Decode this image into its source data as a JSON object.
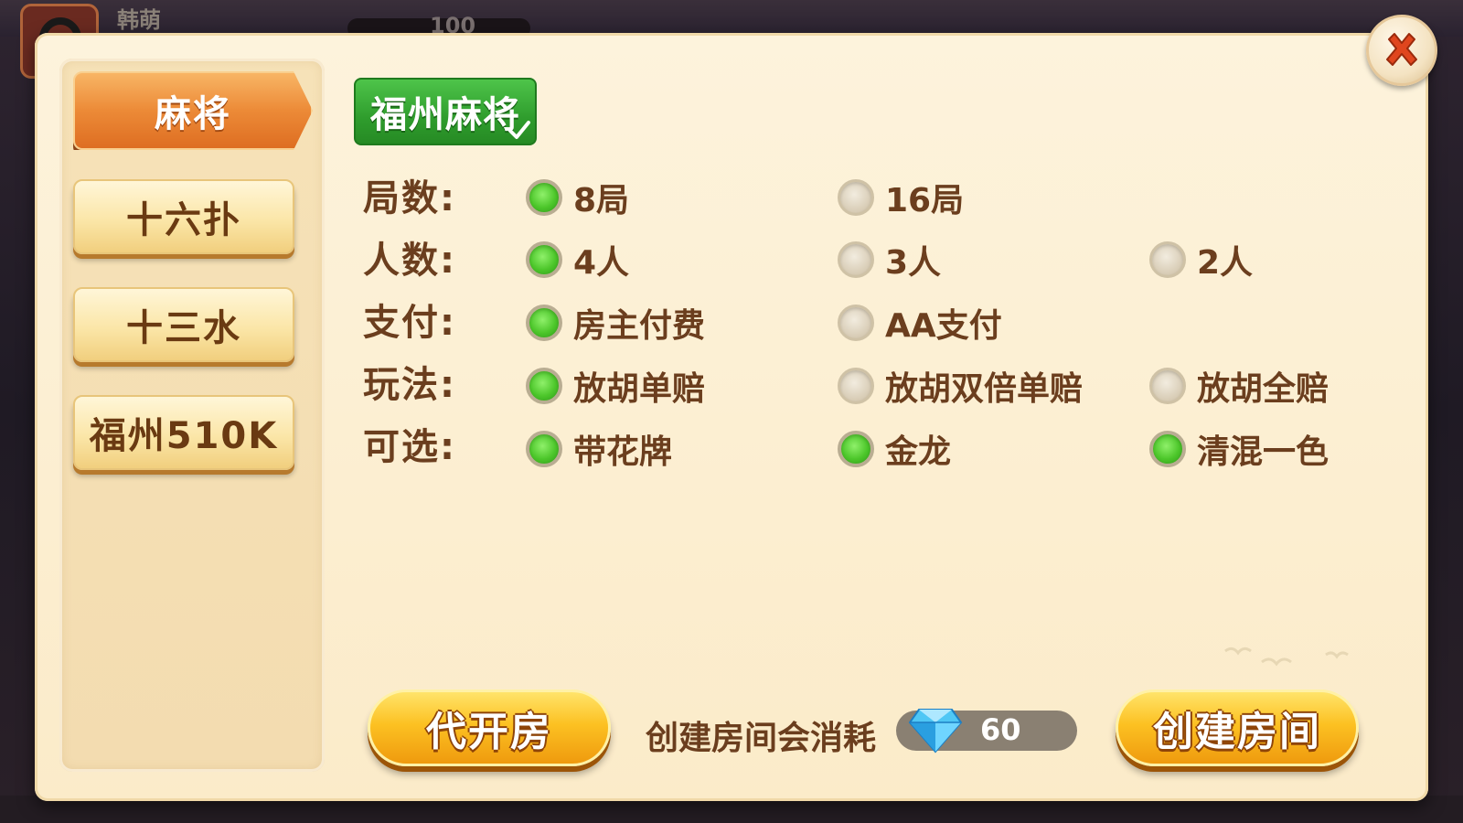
{
  "background": {
    "player_name": "韩萌",
    "coins": "100"
  },
  "dialog": {
    "close_icon": "close-x-icon"
  },
  "sidebar": {
    "items": [
      {
        "label": "麻将",
        "active": true
      },
      {
        "label": "十六扑",
        "active": false
      },
      {
        "label": "十三水",
        "active": false
      },
      {
        "label": "福州510K",
        "active": false
      }
    ]
  },
  "game_tag": {
    "label": "福州麻将",
    "selected": true
  },
  "rows": [
    {
      "label": "局数:",
      "options": [
        {
          "label": "8局",
          "checked": true
        },
        {
          "label": "16局",
          "checked": false
        }
      ]
    },
    {
      "label": "人数:",
      "options": [
        {
          "label": "4人",
          "checked": true
        },
        {
          "label": "3人",
          "checked": false
        },
        {
          "label": "2人",
          "checked": false
        }
      ]
    },
    {
      "label": "支付:",
      "options": [
        {
          "label": "房主付费",
          "checked": true
        },
        {
          "label": "AA支付",
          "checked": false
        }
      ]
    },
    {
      "label": "玩法:",
      "options": [
        {
          "label": "放胡单赔",
          "checked": true
        },
        {
          "label": "放胡双倍单赔",
          "checked": false
        },
        {
          "label": "放胡全赔",
          "checked": false
        }
      ]
    },
    {
      "label": "可选:",
      "options": [
        {
          "label": "带花牌",
          "checked": true
        },
        {
          "label": "金龙",
          "checked": true
        },
        {
          "label": "清混一色",
          "checked": true
        }
      ]
    }
  ],
  "footer": {
    "proxy_room_button": "代开房",
    "cost_text": "创建房间会消耗",
    "cost_icon": "diamond-icon",
    "cost_value": "60",
    "create_room_button": "创建房间"
  },
  "colors": {
    "accent_green": "#3aaf34",
    "accent_orange": "#ec8a37",
    "gold": "#fcc122",
    "text_brown": "#6b3e1e",
    "panel_bg": "#fbebc9"
  }
}
